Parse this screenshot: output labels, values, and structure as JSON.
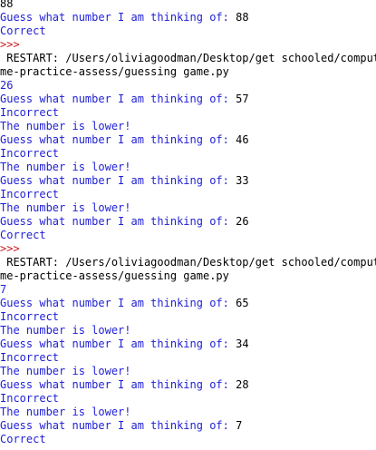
{
  "colors": {
    "stdout": "#1f1fd6",
    "stdin": "#000000",
    "prompt": "#c8191e",
    "background": "#ffffff"
  },
  "shell": {
    "lines": [
      {
        "kind": "input",
        "text": "88"
      },
      {
        "kind": "mixed",
        "prompt_text": "Guess what number I am thinking of: ",
        "input_text": "88"
      },
      {
        "kind": "output",
        "text": "Correct"
      },
      {
        "kind": "prompt",
        "text": ">>>"
      },
      {
        "kind": "restart",
        "text": " RESTART: /Users/oliviagoodman/Desktop/get schooled/computer-"
      },
      {
        "kind": "restart",
        "text": "me-practice-assess/guessing game.py"
      },
      {
        "kind": "output",
        "text": "26"
      },
      {
        "kind": "mixed",
        "prompt_text": "Guess what number I am thinking of: ",
        "input_text": "57"
      },
      {
        "kind": "output",
        "text": "Incorrect"
      },
      {
        "kind": "output",
        "text": "The number is lower!"
      },
      {
        "kind": "mixed",
        "prompt_text": "Guess what number I am thinking of: ",
        "input_text": "46"
      },
      {
        "kind": "output",
        "text": "Incorrect"
      },
      {
        "kind": "output",
        "text": "The number is lower!"
      },
      {
        "kind": "mixed",
        "prompt_text": "Guess what number I am thinking of: ",
        "input_text": "33"
      },
      {
        "kind": "output",
        "text": "Incorrect"
      },
      {
        "kind": "output",
        "text": "The number is lower!"
      },
      {
        "kind": "mixed",
        "prompt_text": "Guess what number I am thinking of: ",
        "input_text": "26"
      },
      {
        "kind": "output",
        "text": "Correct"
      },
      {
        "kind": "prompt",
        "text": ">>>"
      },
      {
        "kind": "restart",
        "text": " RESTART: /Users/oliviagoodman/Desktop/get schooled/computer-"
      },
      {
        "kind": "restart",
        "text": "me-practice-assess/guessing game.py"
      },
      {
        "kind": "output",
        "text": "7"
      },
      {
        "kind": "mixed",
        "prompt_text": "Guess what number I am thinking of: ",
        "input_text": "65"
      },
      {
        "kind": "output",
        "text": "Incorrect"
      },
      {
        "kind": "output",
        "text": "The number is lower!"
      },
      {
        "kind": "mixed",
        "prompt_text": "Guess what number I am thinking of: ",
        "input_text": "34"
      },
      {
        "kind": "output",
        "text": "Incorrect"
      },
      {
        "kind": "output",
        "text": "The number is lower!"
      },
      {
        "kind": "mixed",
        "prompt_text": "Guess what number I am thinking of: ",
        "input_text": "28"
      },
      {
        "kind": "output",
        "text": "Incorrect"
      },
      {
        "kind": "output",
        "text": "The number is lower!"
      },
      {
        "kind": "mixed",
        "prompt_text": "Guess what number I am thinking of: ",
        "input_text": "7"
      },
      {
        "kind": "output",
        "text": "Correct"
      }
    ]
  }
}
